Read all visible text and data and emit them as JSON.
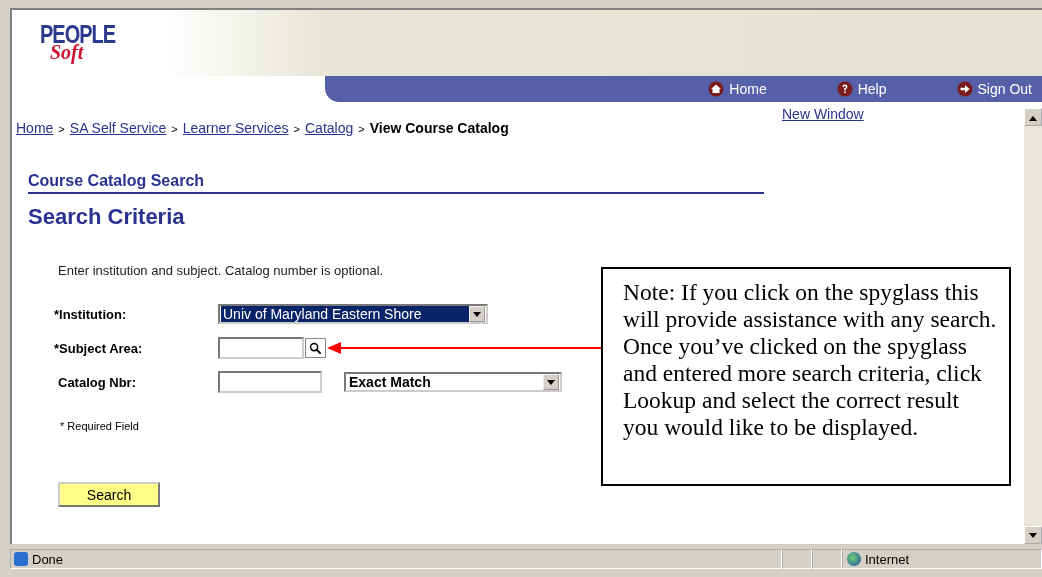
{
  "logo": {
    "top": "PEOPLE",
    "bottom": "Soft"
  },
  "nav": [
    {
      "label": "Home",
      "kind": "home"
    },
    {
      "label": "Help",
      "kind": "help"
    },
    {
      "label": "Sign Out",
      "kind": "signout"
    }
  ],
  "breadcrumb": [
    {
      "label": "Home",
      "kind": "link"
    },
    {
      "label": ">",
      "kind": "separator"
    },
    {
      "label": "SA Self Service",
      "kind": "link"
    },
    {
      "label": ">",
      "kind": "separator"
    },
    {
      "label": "Learner Services",
      "kind": "link"
    },
    {
      "label": ">",
      "kind": "separator"
    },
    {
      "label": "Catalog",
      "kind": "link"
    },
    {
      "label": ">",
      "kind": "separator"
    },
    {
      "label": "View Course Catalog",
      "kind": "current"
    }
  ],
  "new_window": "New Window",
  "section_title": "Course Catalog Search",
  "page_title": "Search Criteria",
  "instructions": "Enter institution and subject. Catalog number is optional.",
  "fields": [
    {
      "label": "*Institution:",
      "kind": "select",
      "value": "Univ of Maryland Eastern Shore",
      "highlighted": true
    },
    {
      "label": "*Subject Area:",
      "kind": "lookup"
    },
    {
      "label": "Catalog Nbr:",
      "kind": "input_select",
      "value": "Exact Match",
      "highlighted": false
    }
  ],
  "required_note": "* Required Field",
  "search_button": "Search",
  "callout": "Note: If you click on the spyglass this will provide assistance with any search. Once you’ve clicked on the spyglass and entered more search criteria, click Lookup and select the correct result you would like to be displayed.",
  "status_bar": {
    "text": "Done",
    "zone": "Internet"
  }
}
